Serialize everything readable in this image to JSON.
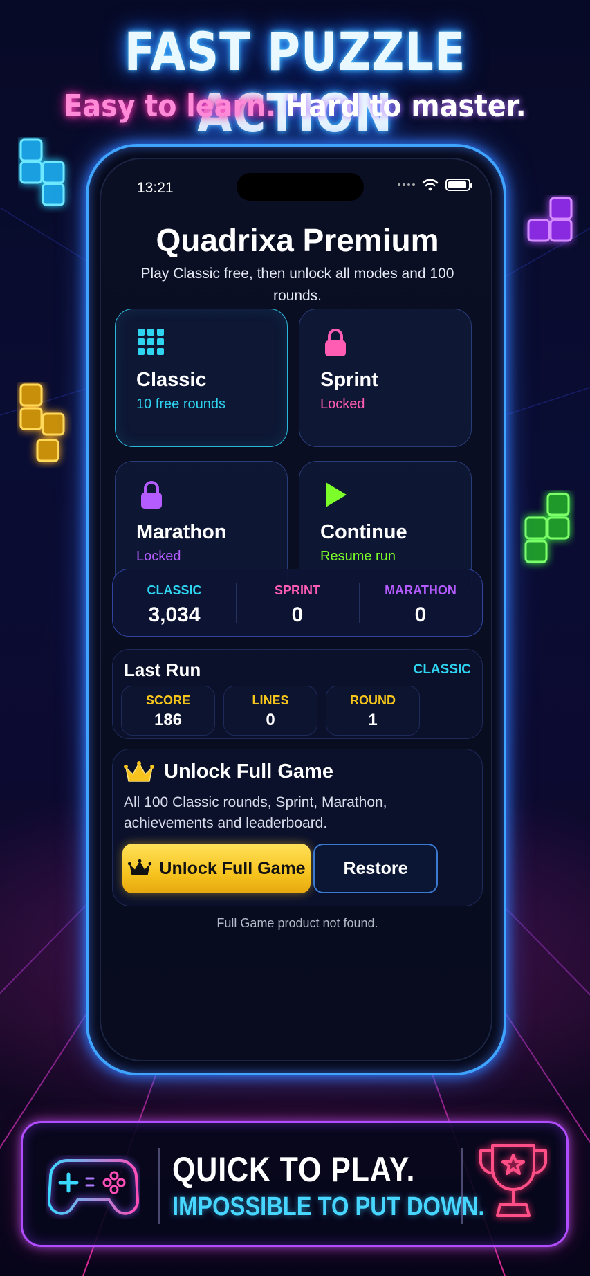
{
  "promo": {
    "headline": "FAST PUZZLE ACTION",
    "subhead_part1": "Easy to learn.",
    "subhead_part2": " Hard to master."
  },
  "status_bar": {
    "time": "13:21"
  },
  "paywall": {
    "title": "Quadrixa Premium",
    "description": "Play Classic free, then unlock all modes and 100 rounds."
  },
  "modes": [
    {
      "name": "Classic",
      "status": "10 free rounds",
      "icon": "grid-icon",
      "color": "#2fd4f0"
    },
    {
      "name": "Sprint",
      "status": "Locked",
      "icon": "lock-icon",
      "color": "#ff5cb4"
    },
    {
      "name": "Marathon",
      "status": "Locked",
      "icon": "lock-icon",
      "color": "#b45cff"
    },
    {
      "name": "Continue",
      "status": "Resume run",
      "icon": "play-icon",
      "color": "#7dff2a"
    }
  ],
  "high_scores": [
    {
      "label": "CLASSIC",
      "value": "3,034",
      "color": "#2fd4f0"
    },
    {
      "label": "SPRINT",
      "value": "0",
      "color": "#ff5cb4"
    },
    {
      "label": "MARATHON",
      "value": "0",
      "color": "#b45cff"
    }
  ],
  "last_run": {
    "title": "Last Run",
    "mode": "CLASSIC",
    "stats": [
      {
        "label": "SCORE",
        "value": "186"
      },
      {
        "label": "LINES",
        "value": "0"
      },
      {
        "label": "ROUND",
        "value": "1"
      }
    ]
  },
  "unlock": {
    "title": "Unlock Full Game",
    "description": "All 100 Classic rounds, Sprint, Marathon, achievements and leaderboard.",
    "buy_label": "Unlock Full Game",
    "restore_label": "Restore",
    "error_text": "Full Game product not found."
  },
  "banner": {
    "line1": "QUICK TO PLAY.",
    "line2": "IMPOSSIBLE TO PUT DOWN."
  },
  "colors": {
    "cyan": "#2fd4f0",
    "pink": "#ff5cb4",
    "purple": "#b45cff",
    "green": "#7dff2a",
    "gold": "#f7c41f"
  }
}
